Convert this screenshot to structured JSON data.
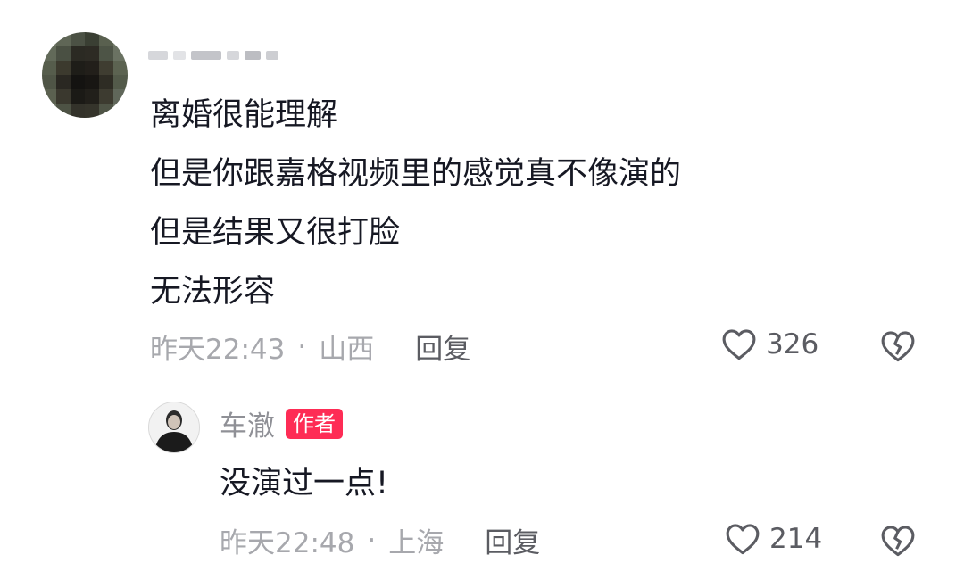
{
  "comment": {
    "lines": [
      "离婚很能理解",
      "但是你跟嘉格视频里的感觉真不像演的",
      "但是结果又很打脸",
      "无法形容"
    ],
    "time": "昨天22:43",
    "separator": "·",
    "location": "山西",
    "reply_label": "回复",
    "likes": "326"
  },
  "reply": {
    "username": "车澈",
    "badge": "作者",
    "text": "没演过一点!",
    "time": "昨天22:48",
    "separator": "·",
    "location": "上海",
    "reply_label": "回复",
    "likes": "214"
  },
  "colors": {
    "badge": "#fe2c55",
    "meta": "#a7a8ad",
    "text": "#161823"
  },
  "icons": [
    "heart-outline-icon",
    "broken-heart-icon"
  ]
}
